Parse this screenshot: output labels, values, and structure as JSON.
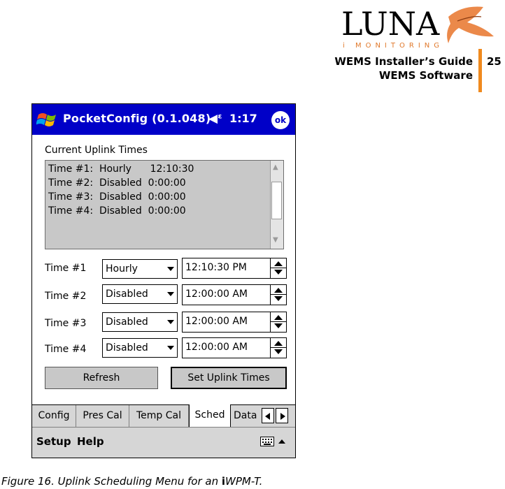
{
  "header": {
    "logo_wordmark": "LUNA",
    "logo_subtitle": "i MONITORING",
    "guide_title": "WEMS Installer’s Guide",
    "section": "WEMS Software",
    "page_number": "25",
    "accent_color": "#f08a1e"
  },
  "device": {
    "titlebar": {
      "app_title": "PocketConfig (0.1.048)",
      "volume_icon": "speaker-icon",
      "time": "1:17",
      "ok_label": "ok",
      "bar_color": "#0000c8"
    },
    "current_uplink": {
      "label": "Current Uplink Times",
      "lines": [
        "Time #1:  Hourly      12:10:30",
        "Time #2:  Disabled  0:00:00",
        "Time #3:  Disabled  0:00:00",
        "Time #4:  Disabled  0:00:00"
      ]
    },
    "times": [
      {
        "label": "Time #1",
        "mode": "Hourly",
        "time": "12:10:30 PM"
      },
      {
        "label": "Time #2",
        "mode": "Disabled",
        "time": "12:00:00 AM"
      },
      {
        "label": "Time #3",
        "mode": "Disabled",
        "time": "12:00:00 AM"
      },
      {
        "label": "Time #4",
        "mode": "Disabled",
        "time": "12:00:00 AM"
      }
    ],
    "buttons": {
      "refresh": "Refresh",
      "set_uplink": "Set Uplink Times"
    },
    "tabs": [
      {
        "label": "Config"
      },
      {
        "label": "Pres Cal"
      },
      {
        "label": "Temp Cal"
      },
      {
        "label": "Sched",
        "active": true
      },
      {
        "label": "Data"
      }
    ],
    "menu": {
      "setup": "Setup",
      "help": "Help"
    }
  },
  "caption": {
    "prefix": "Figure 16.  Uplink Scheduling Menu for an ",
    "ichar": "i",
    "suffix": "WPM-T."
  }
}
